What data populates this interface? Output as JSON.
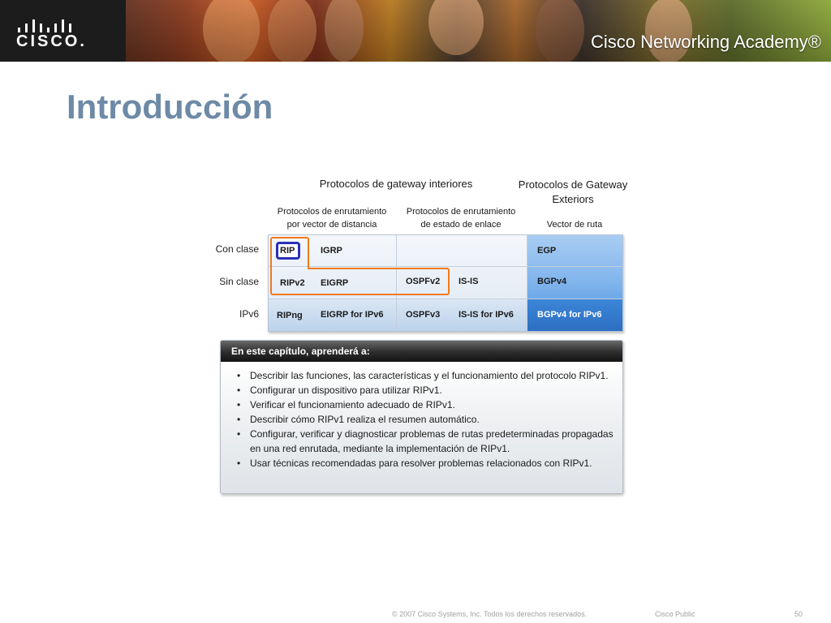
{
  "banner": {
    "logo_text": "CISCO.",
    "academy_text": "Cisco Networking Academy®"
  },
  "slide": {
    "title": "Introducción"
  },
  "protocol_table": {
    "group_headers": {
      "interior": "Protocolos de gateway interiores",
      "exterior_line1": "Protocolos de Gateway",
      "exterior_line2": "Exteriors"
    },
    "sub_headers": {
      "distance_vector_line1": "Protocolos de enrutamiento",
      "distance_vector_line2": "por vector de distancia",
      "link_state_line1": "Protocolos de enrutamiento",
      "link_state_line2": "de estado de enlace",
      "path_vector": "Vector de ruta"
    },
    "rows": [
      {
        "label": "Con clase",
        "dv1": "RIP",
        "dv2": "IGRP",
        "ls1": "",
        "ls2": "",
        "ext": "EGP"
      },
      {
        "label": "Sin clase",
        "dv1": "RIPv2",
        "dv2": "EIGRP",
        "ls1": "OSPFv2",
        "ls2": "IS-IS",
        "ext": "BGPv4"
      },
      {
        "label": "IPv6",
        "dv1": "RIPng",
        "dv2": "EIGRP for IPv6",
        "ls1": "OSPFv3",
        "ls2": "IS-IS for IPv6",
        "ext": "BGPv4 for IPv6"
      }
    ],
    "colors": {
      "highlight_orange": "#f07a1c",
      "highlight_blue": "#2a2fb8",
      "exterior_blue": "#3f8fe0"
    }
  },
  "chapter_box": {
    "heading": "En este capítulo, aprenderá a:",
    "bullet_char": "•",
    "items": [
      "Describir las funciones, las características y el funcionamiento del protocolo RIPv1.",
      "Configurar un dispositivo para utilizar RIPv1.",
      "Verificar el funcionamiento adecuado de RIPv1.",
      "Describir cómo RIPv1 realiza el resumen automático.",
      "Configurar, verificar y diagnosticar problemas de rutas predeterminadas propagadas en una red enrutada, mediante la implementación de RIPv1.",
      "Usar técnicas recomendadas para resolver problemas relacionados con RIPv1."
    ]
  },
  "footer": {
    "copyright": "© 2007 Cisco Systems, Inc. Todos los derechos reservados.",
    "classification": "Cisco Public",
    "page_number": "50"
  }
}
